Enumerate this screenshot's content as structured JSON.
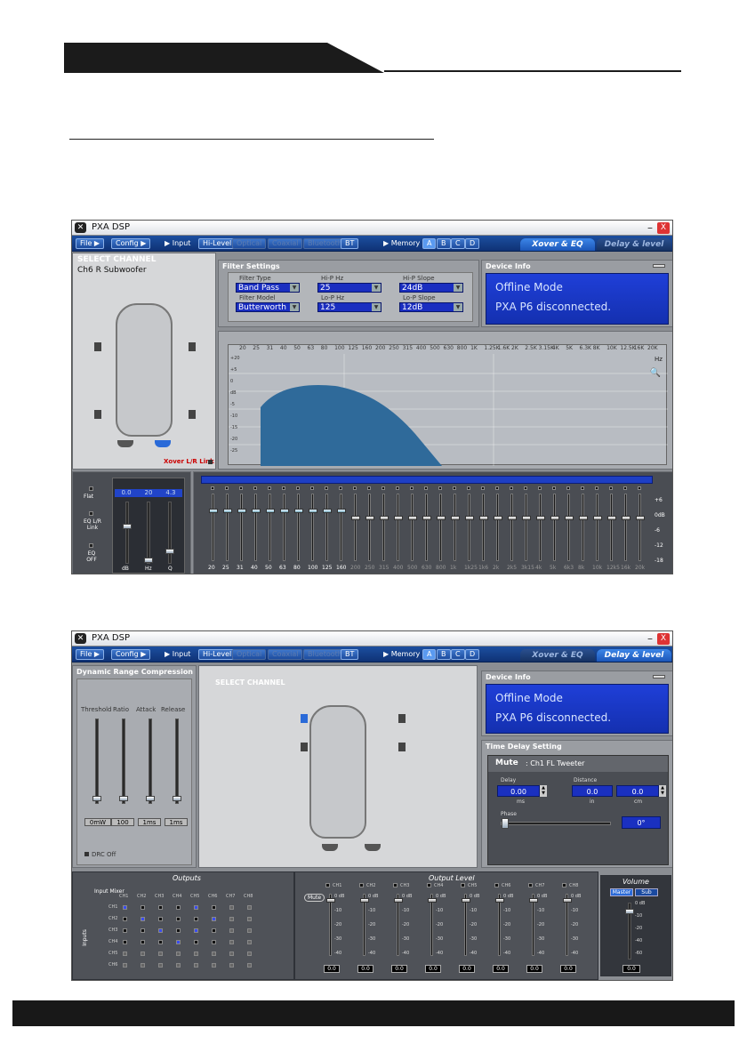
{
  "window1": {
    "title": "PXA DSP",
    "menu": {
      "file": "File",
      "config": "Config",
      "input": "Input",
      "hilevel": "Hi-Level",
      "optical": "Optical",
      "coaxial": "Coaxial",
      "bluetooth": "Bluetooth",
      "bt": "BT",
      "memory": "Memory",
      "mem": [
        "A",
        "B",
        "C",
        "D"
      ]
    },
    "tabs": {
      "xover": "Xover & EQ",
      "delay": "Delay & level"
    },
    "select_channel": {
      "title": "SELECT CHANNEL",
      "channel": "Ch6  R Subwoofer",
      "link": "Xover L/R Link"
    },
    "filter": {
      "title": "Filter Settings",
      "type_label": "Filter Type",
      "type": "Band Pass",
      "model_label": "Filter Model",
      "model": "Butterworth",
      "hip_label": "Hi-P Hz",
      "hip": "25",
      "lop_label": "Lo-P Hz",
      "lop": "125",
      "hips_label": "Hi-P Slope",
      "hips": "24dB",
      "lops_label": "Lo-P Slope",
      "lops": "12dB"
    },
    "device": {
      "title": "Device Info",
      "line1": "Offline Mode",
      "line2": "PXA P6 disconnected."
    },
    "graph": {
      "freqs": [
        "20",
        "25",
        "31",
        "40",
        "50",
        "63",
        "80",
        "100",
        "125",
        "160",
        "200",
        "250",
        "315",
        "400",
        "500",
        "630",
        "800",
        "1K",
        "1.25K",
        "1.6K",
        "2K",
        "2.5K",
        "3.15K",
        "4K",
        "5K",
        "6.3K",
        "8K",
        "10K",
        "12.5K",
        "16K",
        "20K"
      ],
      "unit": "Hz",
      "db": [
        "+20",
        "+5",
        "0",
        "dB",
        "-5",
        "-10",
        "-15",
        "-20",
        "-25"
      ]
    },
    "eq_left": {
      "flat": "Flat",
      "eqlink": "EQ L/R Link",
      "eqoff": "EQ OFF",
      "q": "Q",
      "gain": "dB",
      "hz": "Hz",
      "vals": [
        "0.0",
        "20",
        "4.3"
      ]
    },
    "eq_bands": [
      "20",
      "25",
      "31",
      "40",
      "50",
      "63",
      "80",
      "100",
      "125",
      "160",
      "200",
      "250",
      "315",
      "400",
      "500",
      "630",
      "800",
      "1k",
      "1k25",
      "1k6",
      "2k",
      "2k5",
      "3k15",
      "4k",
      "5k",
      "6k3",
      "8k",
      "10k",
      "12k5",
      "16k",
      "20k"
    ],
    "eq_scale": [
      "+6",
      "0dB",
      "-6",
      "-12",
      "-18"
    ]
  },
  "window2": {
    "title": "PXA DSP",
    "drc": {
      "title": "Dynamic Range Compression",
      "threshold": "Threshold",
      "ratio": "Ratio",
      "attack": "Attack",
      "release": "Release",
      "vals": [
        "0mW",
        "100",
        "1ms",
        "1ms"
      ],
      "onoff": "DRC Off"
    },
    "select_channel": "SELECT CHANNEL",
    "device": {
      "title": "Device Info",
      "line1": "Offline Mode",
      "line2": "PXA P6 disconnected."
    },
    "delay": {
      "title": "Time Delay Setting",
      "mute": "Mute",
      "channel": ": Ch1  FL Tweeter",
      "delay_label": "Delay",
      "delay": "0.00",
      "ms": "ms",
      "dist_label": "Distance",
      "in": "0.0",
      "in_unit": "in",
      "cm": "0.0",
      "cm_unit": "cm",
      "phase_label": "Phase",
      "phase": "0°"
    },
    "outputs": {
      "title": "Outputs",
      "input_mixer": "Input Mixer",
      "inputs": "Inputs",
      "ch": [
        "CH1",
        "CH2",
        "CH3",
        "CH4",
        "CH5",
        "CH6",
        "CH7",
        "CH8"
      ],
      "rows": [
        "CH1",
        "CH2",
        "CH3",
        "CH4",
        "CH5",
        "CH6"
      ]
    },
    "output_level": {
      "title": "Output Level",
      "mute": "Mute",
      "ch": [
        "CH1",
        "CH2",
        "CH3",
        "CH4",
        "CH5",
        "CH6",
        "CH7",
        "CH8"
      ],
      "scale": [
        "0 dB",
        "-10",
        "-20",
        "-30",
        "-40"
      ],
      "val": "0.0"
    },
    "volume": {
      "title": "Volume",
      "master": "Master",
      "sub": "Sub",
      "scale": [
        "0 dB",
        "-10",
        "-20",
        "-40",
        "-60"
      ],
      "val": "0.0"
    }
  }
}
